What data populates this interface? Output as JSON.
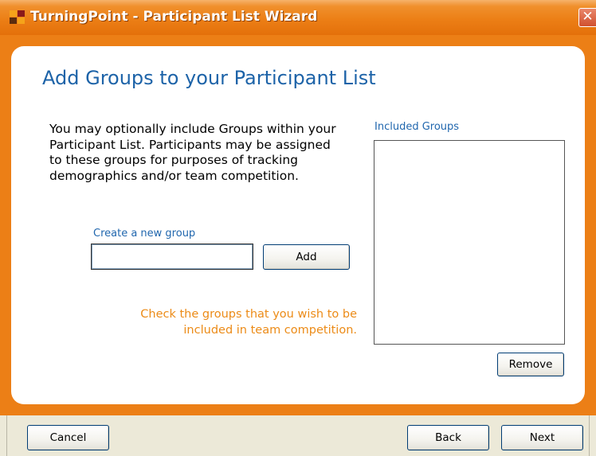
{
  "window": {
    "title": "TurningPoint - Participant List Wizard",
    "close_glyph": "✕",
    "app_icon": "turningpoint-logo-icon",
    "accent_color": "#EC7F16"
  },
  "page": {
    "heading": "Add Groups to your Participant List",
    "description_lines": [
      "You may optionally include Groups within your",
      "Participant List.  Participants may be assigned",
      "to these groups for purposes of tracking",
      "demographics and/or team competition."
    ]
  },
  "create_group": {
    "label": "Create a new group",
    "input_value": "",
    "add_label": "Add"
  },
  "note_lines": [
    "Check the groups that you wish to be",
    "included in team competition."
  ],
  "included_groups": {
    "label": "Included Groups",
    "items": [],
    "remove_label": "Remove"
  },
  "footer": {
    "cancel_label": "Cancel",
    "back_label": "Back",
    "next_label": "Next"
  }
}
